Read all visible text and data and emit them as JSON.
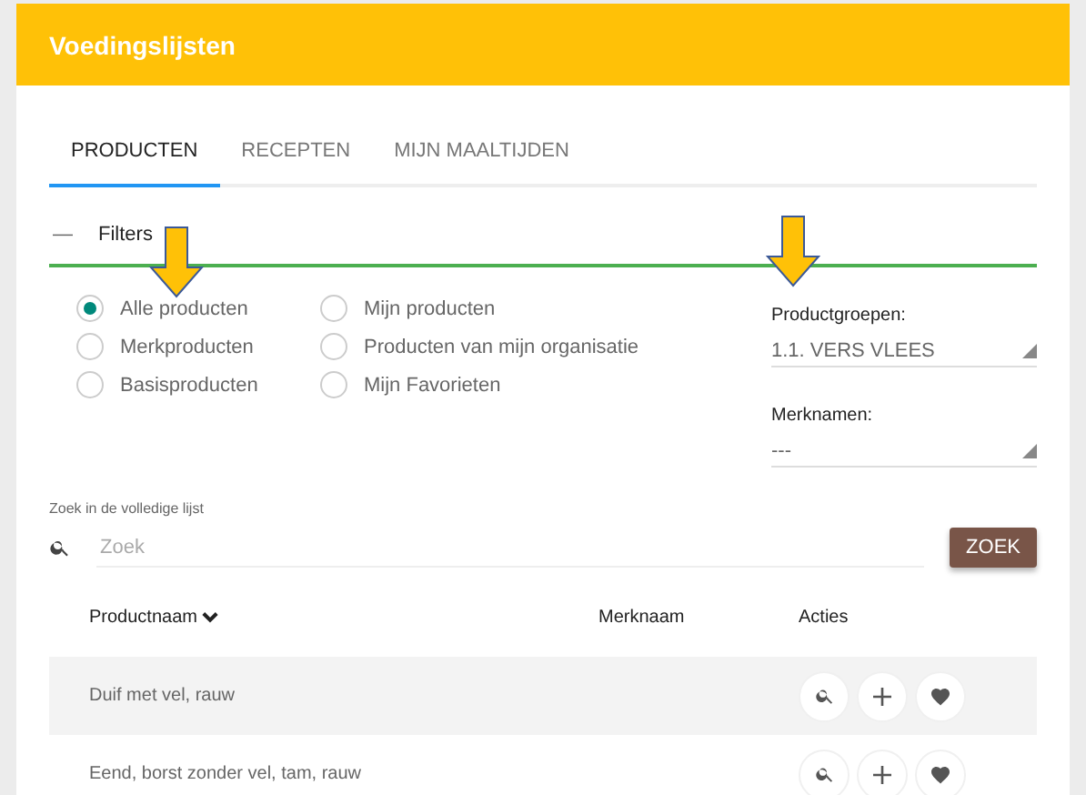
{
  "header": {
    "title": "Voedingslijsten"
  },
  "tabs": [
    {
      "label": "PRODUCTEN",
      "selected": true
    },
    {
      "label": "RECEPTEN",
      "selected": false
    },
    {
      "label": "MIJN MAALTIJDEN",
      "selected": false
    }
  ],
  "filters": {
    "toggle": "—",
    "title": "Filters",
    "expanded": true,
    "options": [
      {
        "label": "Alle producten",
        "selected": true
      },
      {
        "label": "Merkproducten",
        "selected": false
      },
      {
        "label": "Basisproducten",
        "selected": false
      },
      {
        "label": "Mijn producten",
        "selected": false
      },
      {
        "label": "Producten van mijn organisatie",
        "selected": false
      },
      {
        "label": "Mijn Favorieten",
        "selected": false
      }
    ],
    "selects": [
      {
        "label": "Productgroepen:",
        "value": "1.1. VERS VLEES"
      },
      {
        "label": "Merknamen:",
        "value": "---"
      }
    ]
  },
  "search": {
    "label": "Zoek in de volledige lijst",
    "placeholder": "Zoek",
    "button": "ZOEK"
  },
  "table": {
    "columns": [
      "Productnaam",
      "Merknaam",
      "Acties"
    ],
    "rows": [
      {
        "name": "Duif met vel, rauw",
        "brand": "",
        "highlighted": true
      },
      {
        "name": "Eend, borst zonder vel, tam, rauw",
        "brand": "",
        "highlighted": false
      }
    ]
  }
}
